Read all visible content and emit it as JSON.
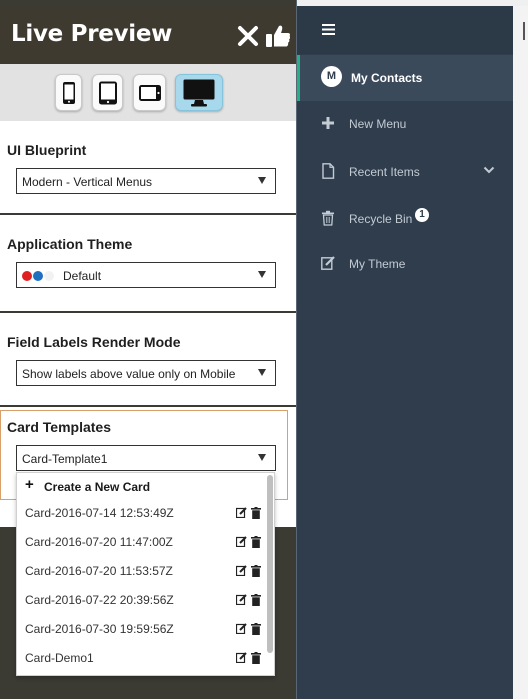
{
  "live_preview": {
    "title": "Live Preview",
    "header_icons": [
      "close-icon",
      "thumbs-up-icon"
    ],
    "devices": [
      "phone-icon",
      "tablet-portrait-icon",
      "tablet-landscape-icon",
      "desktop-icon"
    ],
    "active_device": "desktop-icon",
    "sections": {
      "ui_blueprint": {
        "label": "UI Blueprint",
        "value": "Modern - Vertical Menus"
      },
      "application_theme": {
        "label": "Application Theme",
        "value": "Default",
        "swatch_colors": [
          "#e02020",
          "#1f6fc0"
        ]
      },
      "field_labels": {
        "label": "Field Labels Render Mode",
        "value": "Show labels above value only on Mobile"
      },
      "card_templates": {
        "label": "Card Templates",
        "value": "Card-Template1"
      }
    },
    "card_dropdown": {
      "create_label": "Create a New Card",
      "items": [
        "Card-2016-07-14 12:53:49Z",
        "Card-2016-07-20 11:47:00Z",
        "Card-2016-07-20 11:53:57Z",
        "Card-2016-07-22 20:39:56Z",
        "Card-2016-07-30 19:59:56Z",
        "Card-Demo1"
      ]
    }
  },
  "app_menu": {
    "avatar_letter": "M",
    "items": [
      {
        "label": "My Contacts",
        "icon": "avatar",
        "active": true
      },
      {
        "label": "New Menu",
        "icon": "plus-icon"
      },
      {
        "label": "Recent Items",
        "icon": "document-icon"
      },
      {
        "label": "Recycle Bin",
        "icon": "trash-icon",
        "badge": "1"
      },
      {
        "label": "My Theme",
        "icon": "edit-icon"
      }
    ]
  },
  "colors": {
    "panel_dark": "#3b3a33",
    "nav_bg": "#2f3d4c",
    "active_accent": "#26b08a",
    "selected_device": "#a8d8ec"
  }
}
